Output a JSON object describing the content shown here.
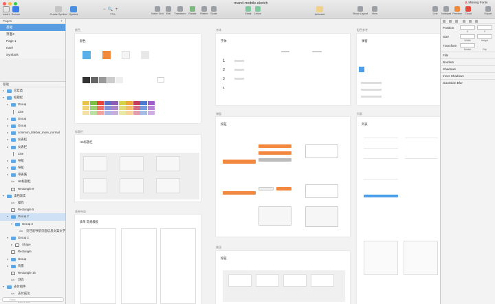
{
  "window": {
    "title": "mand-mobile.sketch",
    "warning_prefix": "⚠",
    "warning": "Missing Fonts"
  },
  "toolbar": {
    "left": [
      "Insert",
      "Runner"
    ],
    "mid1": [
      "Create Symbol",
      "Symbol"
    ],
    "zoom": {
      "minus": "−",
      "value": "77%",
      "plus": "+"
    },
    "mid2": [
      "Make Grid",
      "Edit",
      "Transform",
      "Rotate",
      "Flatten",
      "Scale"
    ],
    "mid3": [
      "Mask",
      "Union"
    ],
    "artboard": "Artboard",
    "view": [
      "Show Layout",
      "View"
    ],
    "right": [
      "Link",
      "Notepad",
      "Preview",
      "Cloud",
      "Export"
    ]
  },
  "sidebar": {
    "pages_header": "Pages",
    "pages": [
      "基础",
      "页面4",
      "Page 1",
      "Insel",
      "Symbols"
    ],
    "layers_header": "基础",
    "layers": [
      {
        "t": "arrow",
        "i": "folder",
        "n": "交互类",
        "d": 0
      },
      {
        "t": "open",
        "i": "folder",
        "n": "标题栏",
        "d": 0
      },
      {
        "t": "arrow",
        "i": "folder",
        "n": "Group",
        "d": 1
      },
      {
        "t": "none",
        "i": "line",
        "n": "Line",
        "d": 1
      },
      {
        "t": "arrow",
        "i": "folder",
        "n": "Group",
        "d": 1
      },
      {
        "t": "arrow",
        "i": "folder",
        "n": "Group",
        "d": 1
      },
      {
        "t": "arrow",
        "i": "folder",
        "n": "common_titlebar_more_normal",
        "d": 1
      },
      {
        "t": "arrow",
        "i": "folder",
        "n": "仪表栏",
        "d": 1
      },
      {
        "t": "arrow",
        "i": "folder",
        "n": "仪表栏",
        "d": 1
      },
      {
        "t": "none",
        "i": "line",
        "n": "Line",
        "d": 1
      },
      {
        "t": "arrow",
        "i": "folder",
        "n": "导航",
        "d": 1
      },
      {
        "t": "arrow",
        "i": "folder",
        "n": "导航",
        "d": 1
      },
      {
        "t": "arrow",
        "i": "folder",
        "n": "带表属",
        "d": 1
      },
      {
        "t": "none",
        "i": "text",
        "n": "H5标题栏",
        "d": 1
      },
      {
        "t": "none",
        "i": "shape",
        "n": "Rectangle 8",
        "d": 1
      },
      {
        "t": "open",
        "i": "folder",
        "n": "读档渐实",
        "d": 0
      },
      {
        "t": "none",
        "i": "text",
        "n": "操作",
        "d": 1
      },
      {
        "t": "none",
        "i": "shape",
        "n": "Rectangle 5",
        "d": 1
      },
      {
        "t": "open",
        "i": "folder",
        "n": "Group 2",
        "d": 1,
        "sel": true
      },
      {
        "t": "open",
        "i": "folder",
        "n": "Group 3",
        "d": 2
      },
      {
        "t": "none",
        "i": "text",
        "n": "页已底导航页面信息文案文字",
        "d": 3
      },
      {
        "t": "open",
        "i": "folder",
        "n": "Group 2",
        "d": 1
      },
      {
        "t": "arrow",
        "i": "shape",
        "n": "Shape",
        "d": 2
      },
      {
        "t": "none",
        "i": "shape",
        "n": "Rectangle",
        "d": 1
      },
      {
        "t": "arrow",
        "i": "folder",
        "n": "Group",
        "d": 1
      },
      {
        "t": "arrow",
        "i": "folder",
        "n": "背景",
        "d": 1
      },
      {
        "t": "none",
        "i": "shape",
        "n": "Rectangle 16",
        "d": 1
      },
      {
        "t": "none",
        "i": "text",
        "n": "浏诈",
        "d": 1
      },
      {
        "t": "open",
        "i": "folder",
        "n": "支付组件",
        "d": 0
      },
      {
        "t": "none",
        "i": "text",
        "n": "支付成功",
        "d": 1
      },
      {
        "t": "none",
        "i": "text",
        "n": "支付失败",
        "d": 1
      }
    ],
    "filter_placeholder": "Filter"
  },
  "canvas": {
    "labels": [
      "颜色",
      "字体",
      "配色参考",
      "标题栏",
      "弹窗",
      "列表",
      "表单布局",
      "按钮"
    ],
    "titles": [
      "颜色",
      "字体",
      "弹窗",
      "H5标题栏",
      "按钮",
      "列表",
      "表单 常规模板",
      "按钮"
    ],
    "swatches_row1": [
      "#5ab0e8",
      "#f28a3c",
      "#f5f5f5",
      "#e8e8e8"
    ],
    "swatches_row2": [
      "#333333",
      "#666666",
      "#999999",
      "#cccccc",
      "#eeeeee"
    ],
    "swatches_row3": [
      "#e9c24a",
      "#7ac143",
      "#e5443a",
      "#5b6fc7",
      "#8e5bb7",
      "#d4d24a",
      "#f0a63c",
      "#c33c5a",
      "#4a7bd1",
      "#a05cc8"
    ],
    "font_sizes": [
      "1",
      "2",
      "3",
      "4"
    ]
  },
  "inspector": {
    "position": "Position",
    "x": "X",
    "y": "Y",
    "size": "Size",
    "width": "Width",
    "height": "Height",
    "transform": "Transform",
    "rotate": "Rotate",
    "flip": "Flip",
    "sections": [
      "Fills",
      "Borders",
      "Shadows",
      "Inner Shadows",
      "Gaussian Blur"
    ]
  }
}
